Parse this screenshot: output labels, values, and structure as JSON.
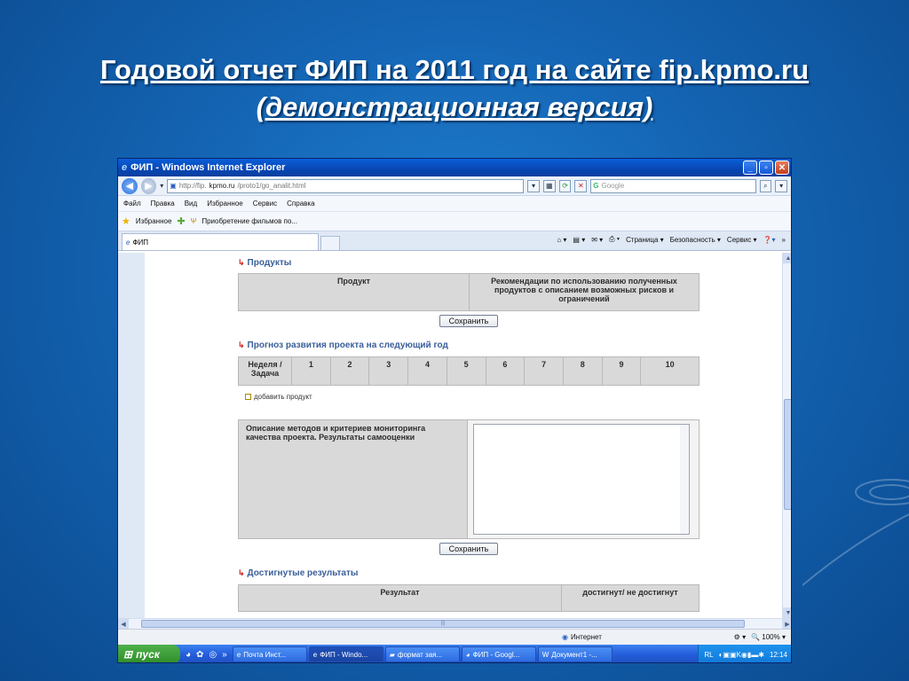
{
  "slide": {
    "title_line1": " Годовой отчет ФИП на 2011 год на сайте fip.kpmo.ru",
    "title_line2": " (демонстрационная версия)"
  },
  "browser": {
    "window_title": "ФИП - Windows Internet Explorer",
    "url_prefix": "http://fip.",
    "url_host": "kpmo.ru",
    "url_path": "/proto1/go_analit.html",
    "search_placeholder": "Google",
    "menu": [
      "Файл",
      "Правка",
      "Вид",
      "Избранное",
      "Сервис",
      "Справка"
    ],
    "favorites_label": "Избранное",
    "favorite_link": "Приобретение фильмов по...",
    "tab_label": "ФИП",
    "command_bar": [
      "Страница ▾",
      "Безопасность ▾",
      "Сервис ▾"
    ]
  },
  "content": {
    "products": {
      "heading": "Продукты",
      "col_product": "Продукт",
      "col_recommendations": "Рекомендации по использованию полученных продуктов с описанием возможных рисков и ограничений",
      "save_label": "Сохранить"
    },
    "forecast": {
      "heading": "Прогноз развития проекта на следующий год",
      "first_col": "Неделя / Задача",
      "weeks": [
        "1",
        "2",
        "3",
        "4",
        "5",
        "6",
        "7",
        "8",
        "9",
        "10"
      ],
      "add_product_label": "добавить продукт"
    },
    "monitoring": {
      "label": "Описание методов и критериев мониторинга качества проекта. Результаты самооценки",
      "text_value": "",
      "save_label": "Сохранить"
    },
    "results": {
      "heading": "Достигнутые результаты",
      "col_result": "Результат",
      "col_achieved": "достигнут/ не достигнут"
    }
  },
  "status": {
    "zone": "Интернет",
    "zoom": "100%"
  },
  "taskbar": {
    "start_label": "пуск",
    "tasks": [
      "Почта Инст...",
      "ФИП - Windo...",
      "формат зая...",
      "ФИП - Googl...",
      "Документ1 -..."
    ],
    "language": "RL",
    "clock": "12:14"
  }
}
